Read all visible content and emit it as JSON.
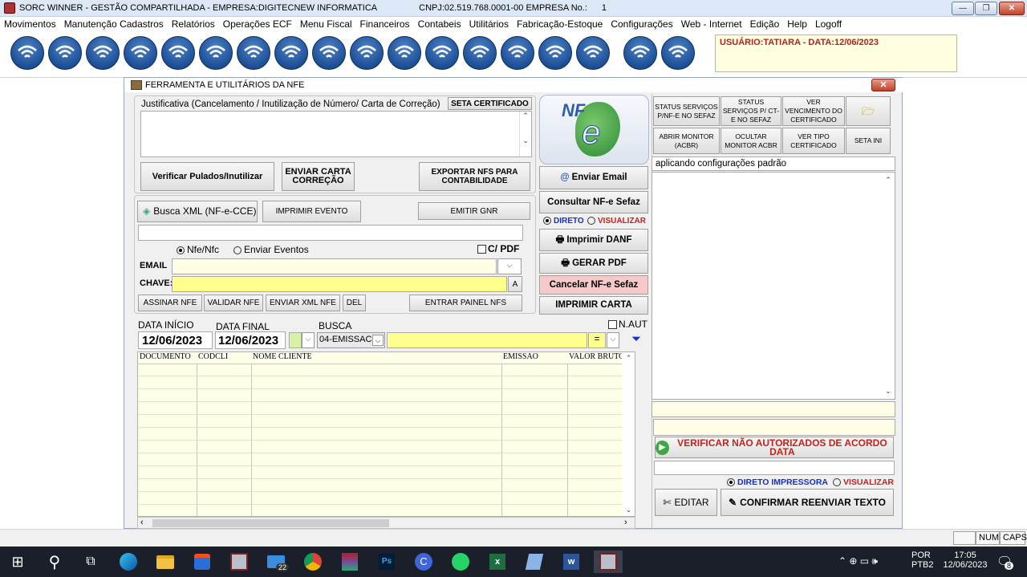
{
  "titlebar": {
    "app": "SORC WINNER - GESTÃO COMPARTILHADA - EMPRESA:DIGITECNEW INFORMATICA",
    "cnpj": "CNPJ:02.519.768.0001-00  EMPRESA No.:",
    "empresa_no": "1",
    "minimize": "—",
    "maximize": "❐",
    "close": "✕"
  },
  "menu": [
    "Movimentos",
    "Manutenção Cadastros",
    "Relatórios",
    "Operações ECF",
    "Menu Fiscal",
    "Financeiros",
    "Contabeis",
    "Utilitários",
    "Fabricação-Estoque",
    "Configurações",
    "Web - Internet",
    "Edição",
    "Help",
    "Logoff"
  ],
  "user_info": "USUÁRIO:TATIARA - DATA:12/06/2023",
  "window": {
    "title": "FERRAMENTA E UTILITÁRIOS DA  NFE",
    "close": "✕"
  },
  "justificativa": {
    "label": "Justificativa (Cancelamento / Inutilização  de Número/ Carta de Correção)",
    "seta_certificado": "SETA CERTIFICADO",
    "value": ""
  },
  "buttons": {
    "verificar_pulados": "Verificar Pulados/Inutilizar",
    "enviar_carta": "ENVIAR CARTA CORREÇÃO",
    "exportar_nfs": "EXPORTAR NFS  PARA CONTABILIDADE",
    "busca_xml": "Busca XML (NF-e-CCE)",
    "imprimir_evento": "IMPRIMIR EVENTO",
    "emitir_gnr": "EMITIR GNR",
    "assinar_nfe": "ASSINAR NFE",
    "validar_nfe": "VALIDAR NFE",
    "enviar_xml": "ENVIAR XML  NFE",
    "del": "DEL",
    "entrar_painel": "ENTRAR PAINEL NFS",
    "enviar_email": "Enviar Email",
    "consultar_nfe": "Consultar NF-e Sefaz",
    "imprimir_danf": "Imprimir DANF",
    "gerar_pdf": "GERAR PDF",
    "cancelar_nfe": "Cancelar NF-e Sefaz",
    "imprimir_carta": "IMPRIMIR CARTA",
    "status_servicos": "STATUS SERVIÇOS P/NF-E NO SEFAZ",
    "status_servicos_cte": "STATUS SERVIÇOS  P/ CT-E NO SEFAZ",
    "ver_vencimento": "VER VENCIMENTO DO CERTIFICADO",
    "abrir_monitor": "ABRIR  MONITOR (ACBR)",
    "ocultar_monitor": "OCULTAR MONITOR ACBR",
    "ver_tipo_cert": "VER TIPO CERTIFICADO",
    "seta_ini": "SETA INI",
    "verificar_nao_aut": "VERIFICAR NÃO AUTORIZADOS DE ACORDO DATA",
    "editar": "EDITAR",
    "confirmar_reenviar": "CONFIRMAR REENVIAR TEXTO"
  },
  "radios": {
    "nfe_nfc": "Nfe/Nfc",
    "enviar_eventos": "Enviar Eventos",
    "c_pdf": "C/ PDF",
    "direto": "DIRETO",
    "visualizar": "VISUALIZAR",
    "direto_impressora": "DIRETO  IMPRESSORA",
    "visualizar2": "VISUALIZAR"
  },
  "fields": {
    "email_label": "EMAIL",
    "chave_label": "CHAVE:",
    "chave_btn": "A",
    "email_value": "",
    "chave_value": ""
  },
  "filters": {
    "data_inicio_label": "DATA INÍCIO",
    "data_final_label": "DATA FINAL",
    "busca_label": "BUSCA",
    "n_aut": "N.AUT",
    "data_inicio": "12/06/2023",
    "data_final": "12/06/2023",
    "busca_value": "04-EMISSAC",
    "operator": "="
  },
  "grid": {
    "columns": [
      "DOCUMENTO",
      "CODCLI",
      "NOME CLIENTE",
      "EMISSAO",
      "VALOR BRUTO"
    ]
  },
  "log": {
    "status_line": "aplicando configurações padrão"
  },
  "nfe_logo": {
    "text": "NF",
    "letter": "e"
  },
  "statusbar": {
    "num": "NUM",
    "caps": "CAPS"
  },
  "taskbar": {
    "badge_mail": "22",
    "lang1": "POR",
    "lang2": "PTB2",
    "time": "17:05",
    "date": "12/06/2023",
    "notif": "8"
  },
  "colors": {
    "accent_red": "#b5221c",
    "accent_blue": "#1530c8",
    "highlight_yellow": "#ffff8e"
  }
}
